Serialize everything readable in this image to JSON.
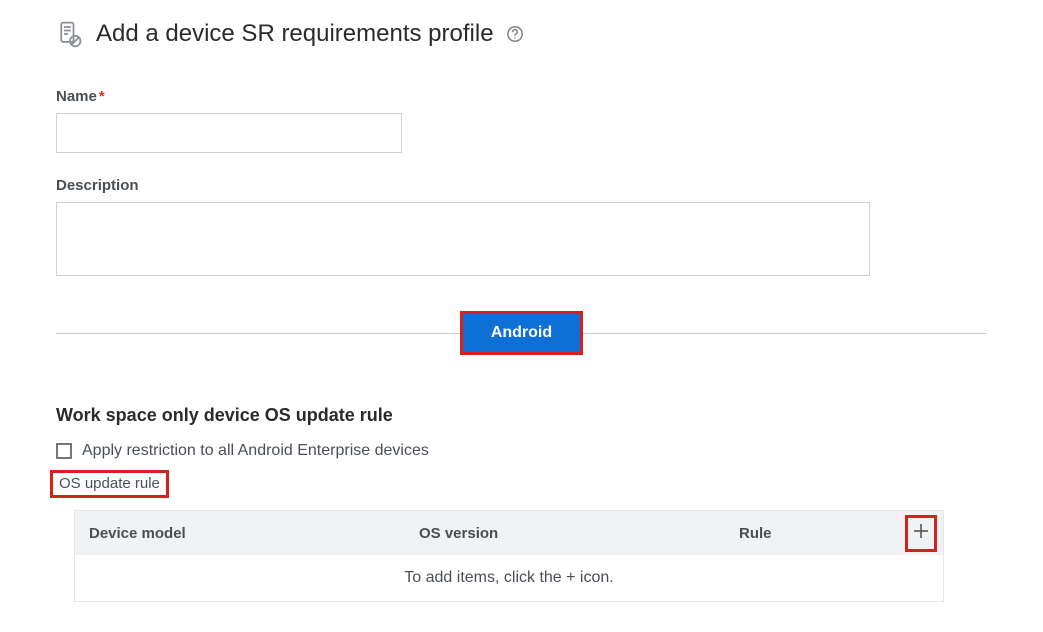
{
  "header": {
    "title": "Add a device SR requirements profile"
  },
  "fields": {
    "name_label": "Name",
    "name_required": "*",
    "name_value": "",
    "desc_label": "Description",
    "desc_value": ""
  },
  "tabs": {
    "android": "Android"
  },
  "section": {
    "title": "Work space only device OS update rule",
    "checkbox_label": "Apply restriction to all Android Enterprise devices",
    "rule_label": "OS update rule"
  },
  "table": {
    "col_model": "Device model",
    "col_os": "OS version",
    "col_rule": "Rule",
    "empty_msg": "To add items, click the + icon."
  }
}
